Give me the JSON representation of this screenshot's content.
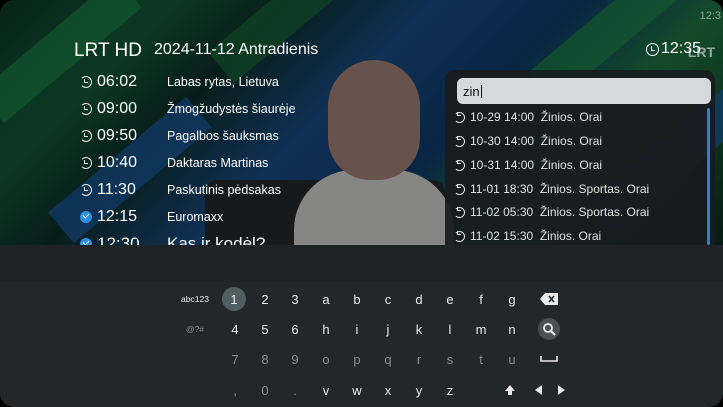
{
  "channel": "LRT HD",
  "date": "2024-11-12 Antradienis",
  "clock": "12:35",
  "corner_clock": "12:3",
  "watermark": "LRT",
  "schedule": [
    {
      "time": "06:02",
      "title": "Labas rytas, Lietuva",
      "icon": "history-icon"
    },
    {
      "time": "09:00",
      "title": "Žmogžudystės šiaurėje",
      "icon": "history-icon"
    },
    {
      "time": "09:50",
      "title": "Pagalbos šauksmas",
      "icon": "history-icon"
    },
    {
      "time": "10:40",
      "title": "Daktaras Martinas",
      "icon": "history-icon"
    },
    {
      "time": "11:30",
      "title": "Paskutinis pėdsakas",
      "icon": "history-icon"
    },
    {
      "time": "12:15",
      "title": "Euromaxx",
      "icon": "live-check-icon"
    },
    {
      "time": "12:30",
      "title": "Kas ir kodėl?",
      "icon": "live-check-icon"
    }
  ],
  "search": {
    "value": "zin",
    "results": [
      "10-29 14:00  Žinios. Orai",
      "10-30 14:00  Žinios. Orai",
      "10-31 14:00  Žinios. Orai",
      "11-01 18:30  Žinios. Sportas. Orai",
      "11-02 05:30  Žinios. Sportas. Orai",
      "11-02 15:30  Žinios. Orai"
    ]
  },
  "keyboard": {
    "mode_abc": "abc123",
    "mode_sym": "@?#",
    "digits_row1": [
      "1",
      "2",
      "3"
    ],
    "digits_row2": [
      "4",
      "5",
      "6"
    ],
    "digits_row3": [
      "7",
      "8",
      "9"
    ],
    "digits_row4": [
      ",",
      "0",
      "."
    ],
    "letters_row1": [
      "a",
      "b",
      "c",
      "d",
      "e",
      "f",
      "g"
    ],
    "letters_row2": [
      "h",
      "i",
      "j",
      "k",
      "l",
      "m",
      "n"
    ],
    "letters_row3": [
      "o",
      "p",
      "q",
      "r",
      "s",
      "t",
      "u"
    ],
    "letters_row4": [
      "v",
      "w",
      "x",
      "y",
      "z"
    ],
    "selected_key": "1",
    "icons": [
      "backspace-icon",
      "search-icon",
      "space-icon",
      "shift-icon",
      "arrow-left-icon",
      "arrow-right-icon"
    ]
  },
  "colors": {
    "accent": "#2d8ee3",
    "keyboard_bg": "#23272a",
    "selected_key": "#4f5e63"
  }
}
